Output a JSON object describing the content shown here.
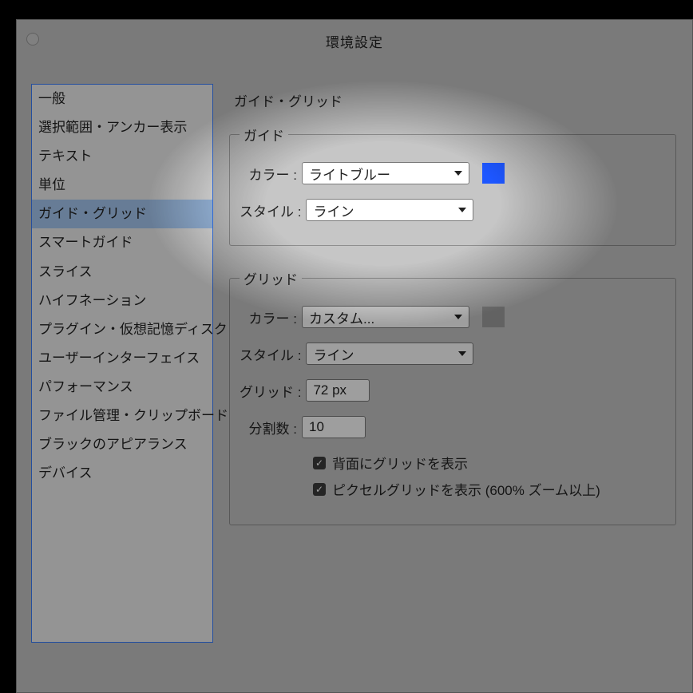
{
  "window": {
    "title": "環境設定"
  },
  "sidebar": {
    "items": [
      "一般",
      "選択範囲・アンカー表示",
      "テキスト",
      "単位",
      "ガイド・グリッド",
      "スマートガイド",
      "スライス",
      "ハイフネーション",
      "プラグイン・仮想記憶ディスク",
      "ユーザーインターフェイス",
      "パフォーマンス",
      "ファイル管理・クリップボード",
      "ブラックのアピアランス",
      "デバイス"
    ],
    "selected_index": 4
  },
  "panel": {
    "title": "ガイド・グリッド",
    "guide": {
      "legend": "ガイド",
      "color_label": "カラー :",
      "color_value": "ライトブルー",
      "color_swatch": "#1e57ff",
      "style_label": "スタイル :",
      "style_value": "ライン"
    },
    "grid": {
      "legend": "グリッド",
      "color_label": "カラー :",
      "color_value": "カスタム...",
      "color_swatch": "#9e9e9e",
      "style_label": "スタイル :",
      "style_value": "ライン",
      "grid_label": "グリッド :",
      "grid_value": "72 px",
      "subdiv_label": "分割数 :",
      "subdiv_value": "10",
      "cb1": "背面にグリッドを表示",
      "cb2": "ピクセルグリッドを表示 (600% ズーム以上)"
    }
  }
}
